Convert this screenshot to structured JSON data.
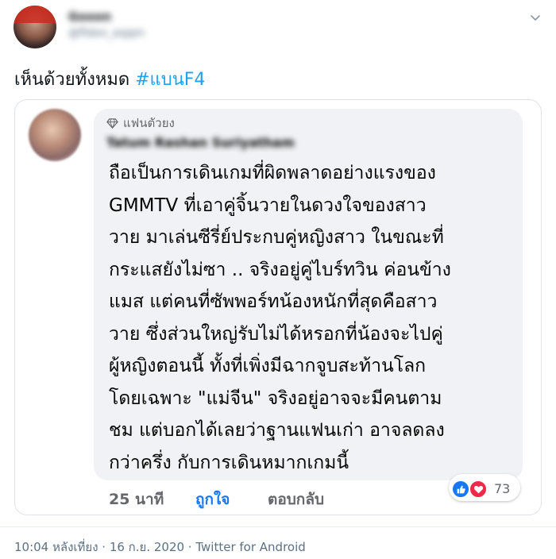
{
  "tweet": {
    "author_name": "Gooon",
    "author_handle": "@fldon_eqqm",
    "text": "เห็นด้วยทั้งหมด ",
    "hashtag": "#แบนF4",
    "meta": "10:04 หลังเที่ยง · 16 ก.ย. 2020 · Twitter for Android"
  },
  "quote": {
    "badge": "แฟนตัวยง",
    "commenter_name": "Tatum Rashan Suriyatham",
    "body_lines": [
      "ถือเป็นการเดินเกมที่ผิดพลาดอย่างแรงของ",
      "GMMTV ที่เอาคู่จิ้นวายในดวงใจของสาว",
      "วาย มาเล่นซีรี่ย์ประกบคู่หญิงสาว ในขณะที่",
      "กระแสยังไม่ซา .. จริงอยู่คู่ไบร์ทวิน ค่อนข้าง",
      "แมส แต่คนที่ซัพพอร์ทน้องหนักที่สุดคือสาว",
      "วาย ซึ่งส่วนใหญ่รับไม่ได้หรอกที่น้องจะไปคู่",
      "ผู้หญิงตอนนี้ ทั้งที่เพิ่งมีฉากจูบสะท้านโลก",
      "โดยเฉพาะ \"แม่จีน\" จริงอยู่อาจจะมีคนตาม",
      "ชม แต่บอกได้เลยว่าฐานแฟนเก่า อาจลดลง",
      "กว่าครึ่ง กับการเดินหมากเกมนี้"
    ],
    "time_ago": "25 นาที",
    "like_label": "ถูกใจ",
    "reply_label": "ตอบกลับ",
    "reaction_count": "73"
  },
  "icons": {
    "menu": "chevron-down-icon",
    "badge": "diamond-icon",
    "like": "thumbs-up-icon",
    "love": "heart-icon"
  },
  "colors": {
    "hashtag": "#1da1f2",
    "like_link": "#1877f2",
    "bubble": "#f0f2f5",
    "love": "#f02849"
  }
}
